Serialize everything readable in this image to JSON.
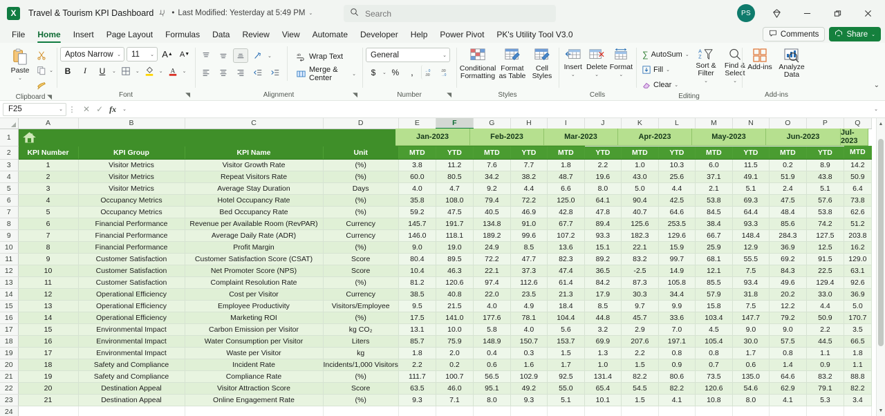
{
  "titlebar": {
    "app_logo": "excel-logo",
    "document_title": "Travel & Tourism KPI Dashboard",
    "autosave_icon": "pin-icon",
    "separator": "•",
    "last_modified": "Last Modified: Yesterday at 5:49 PM",
    "dropdown_caret": "⌄",
    "search_placeholder": "Search",
    "search_value": "",
    "avatar_initials": "PS",
    "copilot_icon": "diamond-icon",
    "minimize": "—",
    "restore": "❐",
    "close": "✕"
  },
  "tabs": [
    {
      "label": "File",
      "active": false
    },
    {
      "label": "Home",
      "active": true
    },
    {
      "label": "Insert",
      "active": false
    },
    {
      "label": "Page Layout",
      "active": false
    },
    {
      "label": "Formulas",
      "active": false
    },
    {
      "label": "Data",
      "active": false
    },
    {
      "label": "Review",
      "active": false
    },
    {
      "label": "View",
      "active": false
    },
    {
      "label": "Automate",
      "active": false
    },
    {
      "label": "Developer",
      "active": false
    },
    {
      "label": "Help",
      "active": false
    },
    {
      "label": "Power Pivot",
      "active": false
    },
    {
      "label": "PK's Utility Tool V3.0",
      "active": false
    }
  ],
  "tab_actions": {
    "comments_label": "Comments",
    "comments_icon": "comment-icon",
    "share_label": "Share",
    "share_icon": "share-icon",
    "share_caret": "⌄"
  },
  "ribbon": {
    "clipboard": {
      "group_label": "Clipboard",
      "paste_label": "Paste",
      "paste_caret": "⌄",
      "cut_icon": "scissors-icon",
      "copy_icon": "copy-icon",
      "format_painter_icon": "format-painter-icon",
      "dialog_launcher": "⌐"
    },
    "font": {
      "group_label": "Font",
      "font_name": "Aptos Narrow",
      "font_size": "11",
      "grow_font": "A",
      "shrink_font": "A",
      "bold": "B",
      "italic": "I",
      "underline": "U",
      "borders_icon": "borders-icon",
      "fill_color_icon": "fill-color-icon",
      "font_color_icon": "font-color-icon",
      "dialog_launcher": "⌐"
    },
    "alignment": {
      "group_label": "Alignment",
      "align_top_icon": "align-top-icon",
      "align_middle_icon": "align-middle-icon",
      "align_bottom_icon": "align-bottom-icon",
      "orientation_icon": "orientation-icon",
      "align_left_icon": "align-left-icon",
      "align_center_icon": "align-center-icon",
      "align_right_icon": "align-right-icon",
      "decrease_indent_icon": "decrease-indent-icon",
      "increase_indent_icon": "increase-indent-icon",
      "wrap_text_label": "Wrap Text",
      "merge_center_label": "Merge & Center",
      "dialog_launcher": "⌐"
    },
    "number": {
      "group_label": "Number",
      "format_value": "General",
      "accounting_icon": "currency-icon",
      "percent_icon": "%",
      "comma_icon": "comma-style-icon",
      "increase_decimal_icon": "increase-decimal-icon",
      "decrease_decimal_icon": "decrease-decimal-icon",
      "dialog_launcher": "⌐"
    },
    "styles": {
      "group_label": "Styles",
      "conditional_formatting": "Conditional Formatting",
      "format_as_table": "Format as Table",
      "cell_styles": "Cell Styles"
    },
    "cells": {
      "group_label": "Cells",
      "insert": "Insert",
      "delete": "Delete",
      "format": "Format"
    },
    "editing": {
      "group_label": "Editing",
      "autosum": "AutoSum",
      "fill": "Fill",
      "clear": "Clear",
      "sort_filter": "Sort & Filter",
      "find_select": "Find & Select"
    },
    "addins": {
      "group_label": "Add-ins",
      "addins_label": "Add-ins",
      "analyze_data_label": "Analyze Data"
    },
    "collapse_caret": "⌄"
  },
  "formula_bar": {
    "name_box_value": "F25",
    "name_box_caret": "⌄",
    "more_icon": "⋮",
    "cancel_icon": "✕",
    "enter_icon": "✓",
    "function_icon": "fx",
    "function_caret": "⌄",
    "formula_value": ""
  },
  "grid": {
    "column_letters": [
      "A",
      "B",
      "C",
      "D",
      "E",
      "F",
      "G",
      "H",
      "I",
      "J",
      "K",
      "L",
      "M",
      "N",
      "O",
      "P",
      "Q"
    ],
    "selected_column": "F",
    "row_numbers": [
      "1",
      "2",
      "3",
      "4",
      "5",
      "6",
      "7",
      "8",
      "9",
      "10",
      "11",
      "12",
      "13",
      "14",
      "15",
      "16",
      "17",
      "18",
      "19",
      "20",
      "21",
      "22",
      "23",
      "24"
    ],
    "banner_icon": "home-icon",
    "headers": [
      "KPI Number",
      "KPI Group",
      "KPI Name",
      "Unit"
    ],
    "months": [
      "Jan-2023",
      "Feb-2023",
      "Mar-2023",
      "Apr-2023",
      "May-2023",
      "Jun-2023",
      "Jul-2023"
    ],
    "sub_headers": [
      "MTD",
      "YTD"
    ],
    "rows": [
      {
        "num": "1",
        "group": "Visitor Metrics",
        "name": "Visitor Growth Rate",
        "unit": "(%)",
        "values": [
          "3.8",
          "11.2",
          "7.6",
          "7.7",
          "1.8",
          "2.2",
          "1.0",
          "10.3",
          "6.0",
          "11.5",
          "0.2",
          "8.9",
          "14.2"
        ]
      },
      {
        "num": "2",
        "group": "Visitor Metrics",
        "name": "Repeat Visitors Rate",
        "unit": "(%)",
        "values": [
          "60.0",
          "80.5",
          "34.2",
          "38.2",
          "48.7",
          "19.6",
          "43.0",
          "25.6",
          "37.1",
          "49.1",
          "51.9",
          "43.8",
          "50.9"
        ]
      },
      {
        "num": "3",
        "group": "Visitor Metrics",
        "name": "Average Stay Duration",
        "unit": "Days",
        "values": [
          "4.0",
          "4.7",
          "9.2",
          "4.4",
          "6.6",
          "8.0",
          "5.0",
          "4.4",
          "2.1",
          "5.1",
          "2.4",
          "5.1",
          "6.4"
        ]
      },
      {
        "num": "4",
        "group": "Occupancy Metrics",
        "name": "Hotel Occupancy Rate",
        "unit": "(%)",
        "values": [
          "35.8",
          "108.0",
          "79.4",
          "72.2",
          "125.0",
          "64.1",
          "90.4",
          "42.5",
          "53.8",
          "69.3",
          "47.5",
          "57.6",
          "73.8"
        ]
      },
      {
        "num": "5",
        "group": "Occupancy Metrics",
        "name": "Bed Occupancy Rate",
        "unit": "(%)",
        "values": [
          "59.2",
          "47.5",
          "40.5",
          "46.9",
          "42.8",
          "47.8",
          "40.7",
          "64.6",
          "84.5",
          "64.4",
          "48.4",
          "53.8",
          "62.6"
        ]
      },
      {
        "num": "6",
        "group": "Financial Performance",
        "name": "Revenue per Available Room (RevPAR)",
        "unit": "Currency",
        "values": [
          "145.7",
          "191.7",
          "134.8",
          "91.0",
          "67.7",
          "89.4",
          "125.6",
          "253.5",
          "38.4",
          "93.3",
          "85.6",
          "74.2",
          "51.2"
        ]
      },
      {
        "num": "7",
        "group": "Financial Performance",
        "name": "Average Daily Rate (ADR)",
        "unit": "Currency",
        "values": [
          "146.0",
          "118.1",
          "189.2",
          "99.6",
          "107.2",
          "93.3",
          "182.3",
          "129.6",
          "66.7",
          "148.4",
          "284.3",
          "127.5",
          "203.8"
        ]
      },
      {
        "num": "8",
        "group": "Financial Performance",
        "name": "Profit Margin",
        "unit": "(%)",
        "values": [
          "9.0",
          "19.0",
          "24.9",
          "8.5",
          "13.6",
          "15.1",
          "22.1",
          "15.9",
          "25.9",
          "12.9",
          "36.9",
          "12.5",
          "16.2"
        ]
      },
      {
        "num": "9",
        "group": "Customer Satisfaction",
        "name": "Customer Satisfaction Score (CSAT)",
        "unit": "Score",
        "values": [
          "80.4",
          "89.5",
          "72.2",
          "47.7",
          "82.3",
          "89.2",
          "83.2",
          "99.7",
          "68.1",
          "55.5",
          "69.2",
          "91.5",
          "129.0"
        ]
      },
      {
        "num": "10",
        "group": "Customer Satisfaction",
        "name": "Net Promoter Score (NPS)",
        "unit": "Score",
        "values": [
          "10.4",
          "46.3",
          "22.1",
          "37.3",
          "47.4",
          "36.5",
          "-2.5",
          "14.9",
          "12.1",
          "7.5",
          "84.3",
          "22.5",
          "63.1"
        ]
      },
      {
        "num": "11",
        "group": "Customer Satisfaction",
        "name": "Complaint Resolution Rate",
        "unit": "(%)",
        "values": [
          "81.2",
          "120.6",
          "97.4",
          "112.6",
          "61.4",
          "84.2",
          "87.3",
          "105.8",
          "85.5",
          "93.4",
          "49.6",
          "129.4",
          "92.6"
        ]
      },
      {
        "num": "12",
        "group": "Operational Efficiency",
        "name": "Cost per Visitor",
        "unit": "Currency",
        "values": [
          "38.5",
          "40.8",
          "22.0",
          "23.5",
          "21.3",
          "17.9",
          "30.3",
          "34.4",
          "57.9",
          "31.8",
          "20.2",
          "33.0",
          "36.9"
        ]
      },
      {
        "num": "13",
        "group": "Operational Efficiency",
        "name": "Employee Productivity",
        "unit": "Visitors/Employee",
        "values": [
          "9.5",
          "21.5",
          "4.0",
          "4.9",
          "18.4",
          "8.5",
          "9.7",
          "9.9",
          "15.8",
          "7.5",
          "12.2",
          "4.4",
          "5.0"
        ]
      },
      {
        "num": "14",
        "group": "Operational Efficiency",
        "name": "Marketing ROI",
        "unit": "(%)",
        "values": [
          "17.5",
          "141.0",
          "177.6",
          "78.1",
          "104.4",
          "44.8",
          "45.7",
          "33.6",
          "103.4",
          "147.7",
          "79.2",
          "50.9",
          "170.7"
        ]
      },
      {
        "num": "15",
        "group": "Environmental Impact",
        "name": "Carbon Emission per Visitor",
        "unit": "kg CO₂",
        "values": [
          "13.1",
          "10.0",
          "5.8",
          "4.0",
          "5.6",
          "3.2",
          "2.9",
          "7.0",
          "4.5",
          "9.0",
          "9.0",
          "2.2",
          "3.5"
        ]
      },
      {
        "num": "16",
        "group": "Environmental Impact",
        "name": "Water Consumption per Visitor",
        "unit": "Liters",
        "values": [
          "85.7",
          "75.9",
          "148.9",
          "150.7",
          "153.7",
          "69.9",
          "207.6",
          "197.1",
          "105.4",
          "30.0",
          "57.5",
          "44.5",
          "66.5"
        ]
      },
      {
        "num": "17",
        "group": "Environmental Impact",
        "name": "Waste per Visitor",
        "unit": "kg",
        "values": [
          "1.8",
          "2.0",
          "0.4",
          "0.3",
          "1.5",
          "1.3",
          "2.2",
          "0.8",
          "0.8",
          "1.7",
          "0.8",
          "1.1",
          "1.8"
        ]
      },
      {
        "num": "18",
        "group": "Safety and Compliance",
        "name": "Incident Rate",
        "unit": "Incidents/1,000 Visitors",
        "values": [
          "2.2",
          "0.2",
          "0.6",
          "1.6",
          "1.7",
          "1.0",
          "1.5",
          "0.9",
          "0.7",
          "0.6",
          "1.4",
          "0.9",
          "1.1"
        ]
      },
      {
        "num": "19",
        "group": "Safety and Compliance",
        "name": "Compliance Rate",
        "unit": "(%)",
        "values": [
          "111.7",
          "100.7",
          "56.5",
          "102.9",
          "92.5",
          "131.4",
          "82.2",
          "80.6",
          "73.5",
          "135.0",
          "64.6",
          "83.2",
          "88.8"
        ]
      },
      {
        "num": "20",
        "group": "Destination Appeal",
        "name": "Visitor Attraction Score",
        "unit": "Score",
        "values": [
          "63.5",
          "46.0",
          "95.1",
          "49.2",
          "55.0",
          "65.4",
          "54.5",
          "82.2",
          "120.6",
          "54.6",
          "62.9",
          "79.1",
          "82.2"
        ]
      },
      {
        "num": "21",
        "group": "Destination Appeal",
        "name": "Online Engagement Rate",
        "unit": "(%)",
        "values": [
          "9.3",
          "7.1",
          "8.0",
          "9.3",
          "5.1",
          "10.1",
          "1.5",
          "4.1",
          "10.8",
          "8.0",
          "4.1",
          "5.3",
          "3.4"
        ]
      }
    ]
  }
}
